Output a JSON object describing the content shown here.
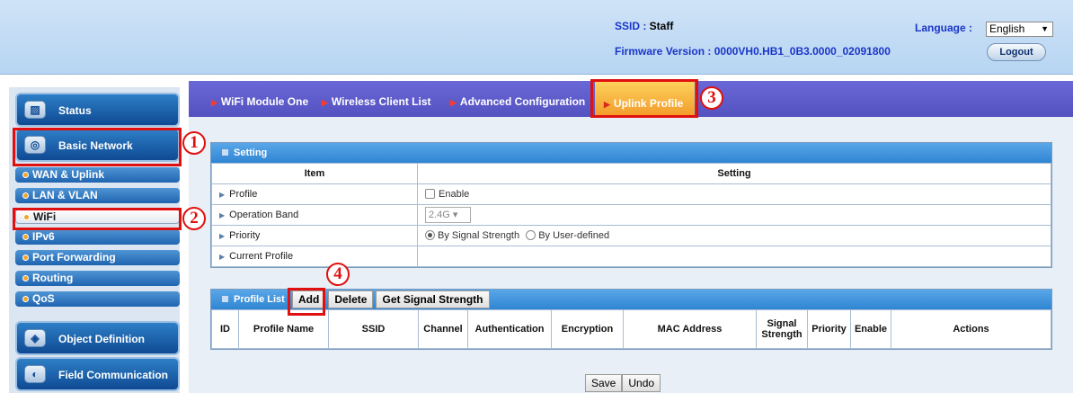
{
  "header": {
    "ssid_label": "SSID : ",
    "ssid_value": "Staff",
    "firmware_label": "Firmware Version : ",
    "firmware_value": "0000VH0.HB1_0B3.0000_02091800",
    "language_label": "Language :",
    "language_value": "English",
    "logout_label": "Logout"
  },
  "sidebar": {
    "status": "Status",
    "basic_network": "Basic Network",
    "wan": "WAN & Uplink",
    "lan": "LAN & VLAN",
    "wifi": "WiFi",
    "ipv6": "IPv6",
    "port_forwarding": "Port Forwarding",
    "routing": "Routing",
    "qos": "QoS",
    "object_definition": "Object Definition",
    "field_communication": "Field Communication"
  },
  "tabs": {
    "wifi_module_one": "WiFi Module One",
    "wireless_client_list": "Wireless Client List",
    "advanced_configuration": "Advanced Configuration",
    "uplink_profile": "Uplink Profile"
  },
  "setting": {
    "title": "Setting",
    "col_item": "Item",
    "col_setting": "Setting",
    "profile_label": "Profile",
    "profile_enable": "Enable",
    "band_label": "Operation Band",
    "band_value": "2.4G",
    "priority_label": "Priority",
    "priority_opt1": "By Signal Strength",
    "priority_opt2": "By User-defined",
    "current_profile_label": "Current Profile"
  },
  "profile_list": {
    "title": "Profile List",
    "add": "Add",
    "delete": "Delete",
    "signal": "Get Signal Strength",
    "columns": {
      "id": "ID",
      "name": "Profile Name",
      "ssid": "SSID",
      "channel": "Channel",
      "auth": "Authentication",
      "enc": "Encryption",
      "mac": "MAC Address",
      "signal_1": "Signal",
      "signal_2": "Strength",
      "priority": "Priority",
      "enable": "Enable",
      "actions": "Actions"
    }
  },
  "footer": {
    "save": "Save",
    "undo": "Undo"
  },
  "annotations": {
    "n1": "1",
    "n2": "2",
    "n3": "3",
    "n4": "4"
  },
  "colors": {
    "annotation_red": "#e01010",
    "tab_bar": "#5a58c8",
    "tab_active": "#f5a830",
    "panel_head": "#3a8fd9",
    "header_link": "#1a36c8"
  }
}
